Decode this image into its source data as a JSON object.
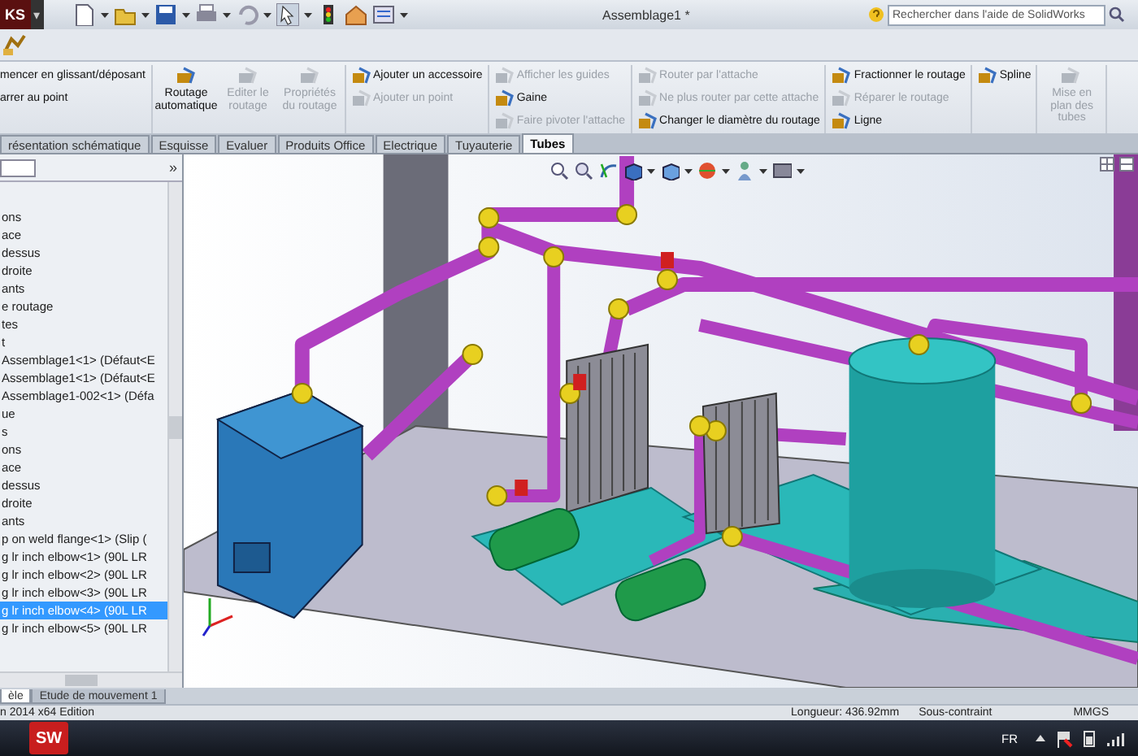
{
  "title_bar": {
    "logo": "KS",
    "menu_glyph": "▾",
    "title": "Assemblage1 *",
    "search": {
      "placeholder": "Rechercher dans l'aide de SolidWorks"
    }
  },
  "ribbon": {
    "groups": [
      {
        "commands": [
          {
            "label": "mencer en glissant/déposant",
            "kind": "text",
            "disabled": false
          },
          {
            "label": "arrer au point",
            "kind": "text",
            "disabled": false
          }
        ]
      },
      {
        "commands": [
          {
            "label": "Routage automatique",
            "kind": "large",
            "disabled": false
          },
          {
            "label": "Editer le routage",
            "kind": "large",
            "disabled": true
          },
          {
            "label": "Propriétés du routage",
            "kind": "large",
            "disabled": true
          }
        ]
      },
      {
        "commands": [
          {
            "label": "Ajouter un accessoire",
            "kind": "small",
            "disabled": false
          },
          {
            "label": "Ajouter un point",
            "kind": "small",
            "disabled": true
          }
        ]
      },
      {
        "commands": [
          {
            "label": "Afficher les guides",
            "kind": "small",
            "disabled": true
          },
          {
            "label": "Gaine",
            "kind": "small",
            "disabled": false
          },
          {
            "label": "Faire pivoter l'attache",
            "kind": "small",
            "disabled": true
          }
        ]
      },
      {
        "commands": [
          {
            "label": "Router par l'attache",
            "kind": "small",
            "disabled": true
          },
          {
            "label": "Ne plus router par cette attache",
            "kind": "small",
            "disabled": true
          },
          {
            "label": "Changer le diamètre du routage",
            "kind": "small",
            "disabled": false
          }
        ]
      },
      {
        "commands": [
          {
            "label": "Fractionner le routage",
            "kind": "small",
            "disabled": false
          },
          {
            "label": "Réparer le routage",
            "kind": "small",
            "disabled": true
          },
          {
            "label": "Ligne",
            "kind": "small",
            "disabled": false
          }
        ]
      },
      {
        "commands": [
          {
            "label": "Spline",
            "kind": "small",
            "disabled": false
          }
        ]
      },
      {
        "commands": [
          {
            "label": "Mise en plan des tubes",
            "kind": "large",
            "disabled": true
          }
        ]
      }
    ]
  },
  "ribbon_tabs": [
    {
      "label": "résentation schématique",
      "selected": false
    },
    {
      "label": "Esquisse",
      "selected": false
    },
    {
      "label": "Evaluer",
      "selected": false
    },
    {
      "label": "Produits Office",
      "selected": false
    },
    {
      "label": "Electrique",
      "selected": false
    },
    {
      "label": "Tuyauterie",
      "selected": false
    },
    {
      "label": "Tubes",
      "selected": true
    }
  ],
  "feature_tree": {
    "expand_glyph": "»",
    "items": [
      {
        "label": "ons",
        "selected": false
      },
      {
        "label": "ace",
        "selected": false
      },
      {
        "label": "dessus",
        "selected": false
      },
      {
        "label": "droite",
        "selected": false
      },
      {
        "label": "ants",
        "selected": false
      },
      {
        "label": "e routage",
        "selected": false
      },
      {
        "label": "tes",
        "selected": false
      },
      {
        "label": "t",
        "selected": false
      },
      {
        "label": "Assemblage1<1> (Défaut<E",
        "selected": false
      },
      {
        "label": "Assemblage1<1> (Défaut<E",
        "selected": false
      },
      {
        "label": "Assemblage1-002<1> (Défa",
        "selected": false
      },
      {
        "label": "ue",
        "selected": false
      },
      {
        "label": "s",
        "selected": false
      },
      {
        "label": "ons",
        "selected": false
      },
      {
        "label": "ace",
        "selected": false
      },
      {
        "label": "dessus",
        "selected": false
      },
      {
        "label": "droite",
        "selected": false
      },
      {
        "label": "ants",
        "selected": false
      },
      {
        "label": "p on weld flange<1> (Slip (",
        "selected": false
      },
      {
        "label": "g lr inch elbow<1> (90L LR",
        "selected": false
      },
      {
        "label": "g lr inch elbow<2> (90L LR",
        "selected": false
      },
      {
        "label": "g lr inch elbow<3> (90L LR",
        "selected": false
      },
      {
        "label": "g lr inch elbow<4> (90L LR",
        "selected": true
      },
      {
        "label": "g lr inch elbow<5> (90L LR",
        "selected": false
      }
    ]
  },
  "bottom_tabs": [
    {
      "label": "èle",
      "selected": true
    },
    {
      "label": "Etude de mouvement 1",
      "selected": false
    }
  ],
  "status_bar": {
    "edition": "n 2014 x64 Edition",
    "length": "Longueur: 436.92mm",
    "constraint": "Sous-contraint",
    "units": "MMGS"
  },
  "taskbar": {
    "app_logo": "SW",
    "language": "FR"
  }
}
